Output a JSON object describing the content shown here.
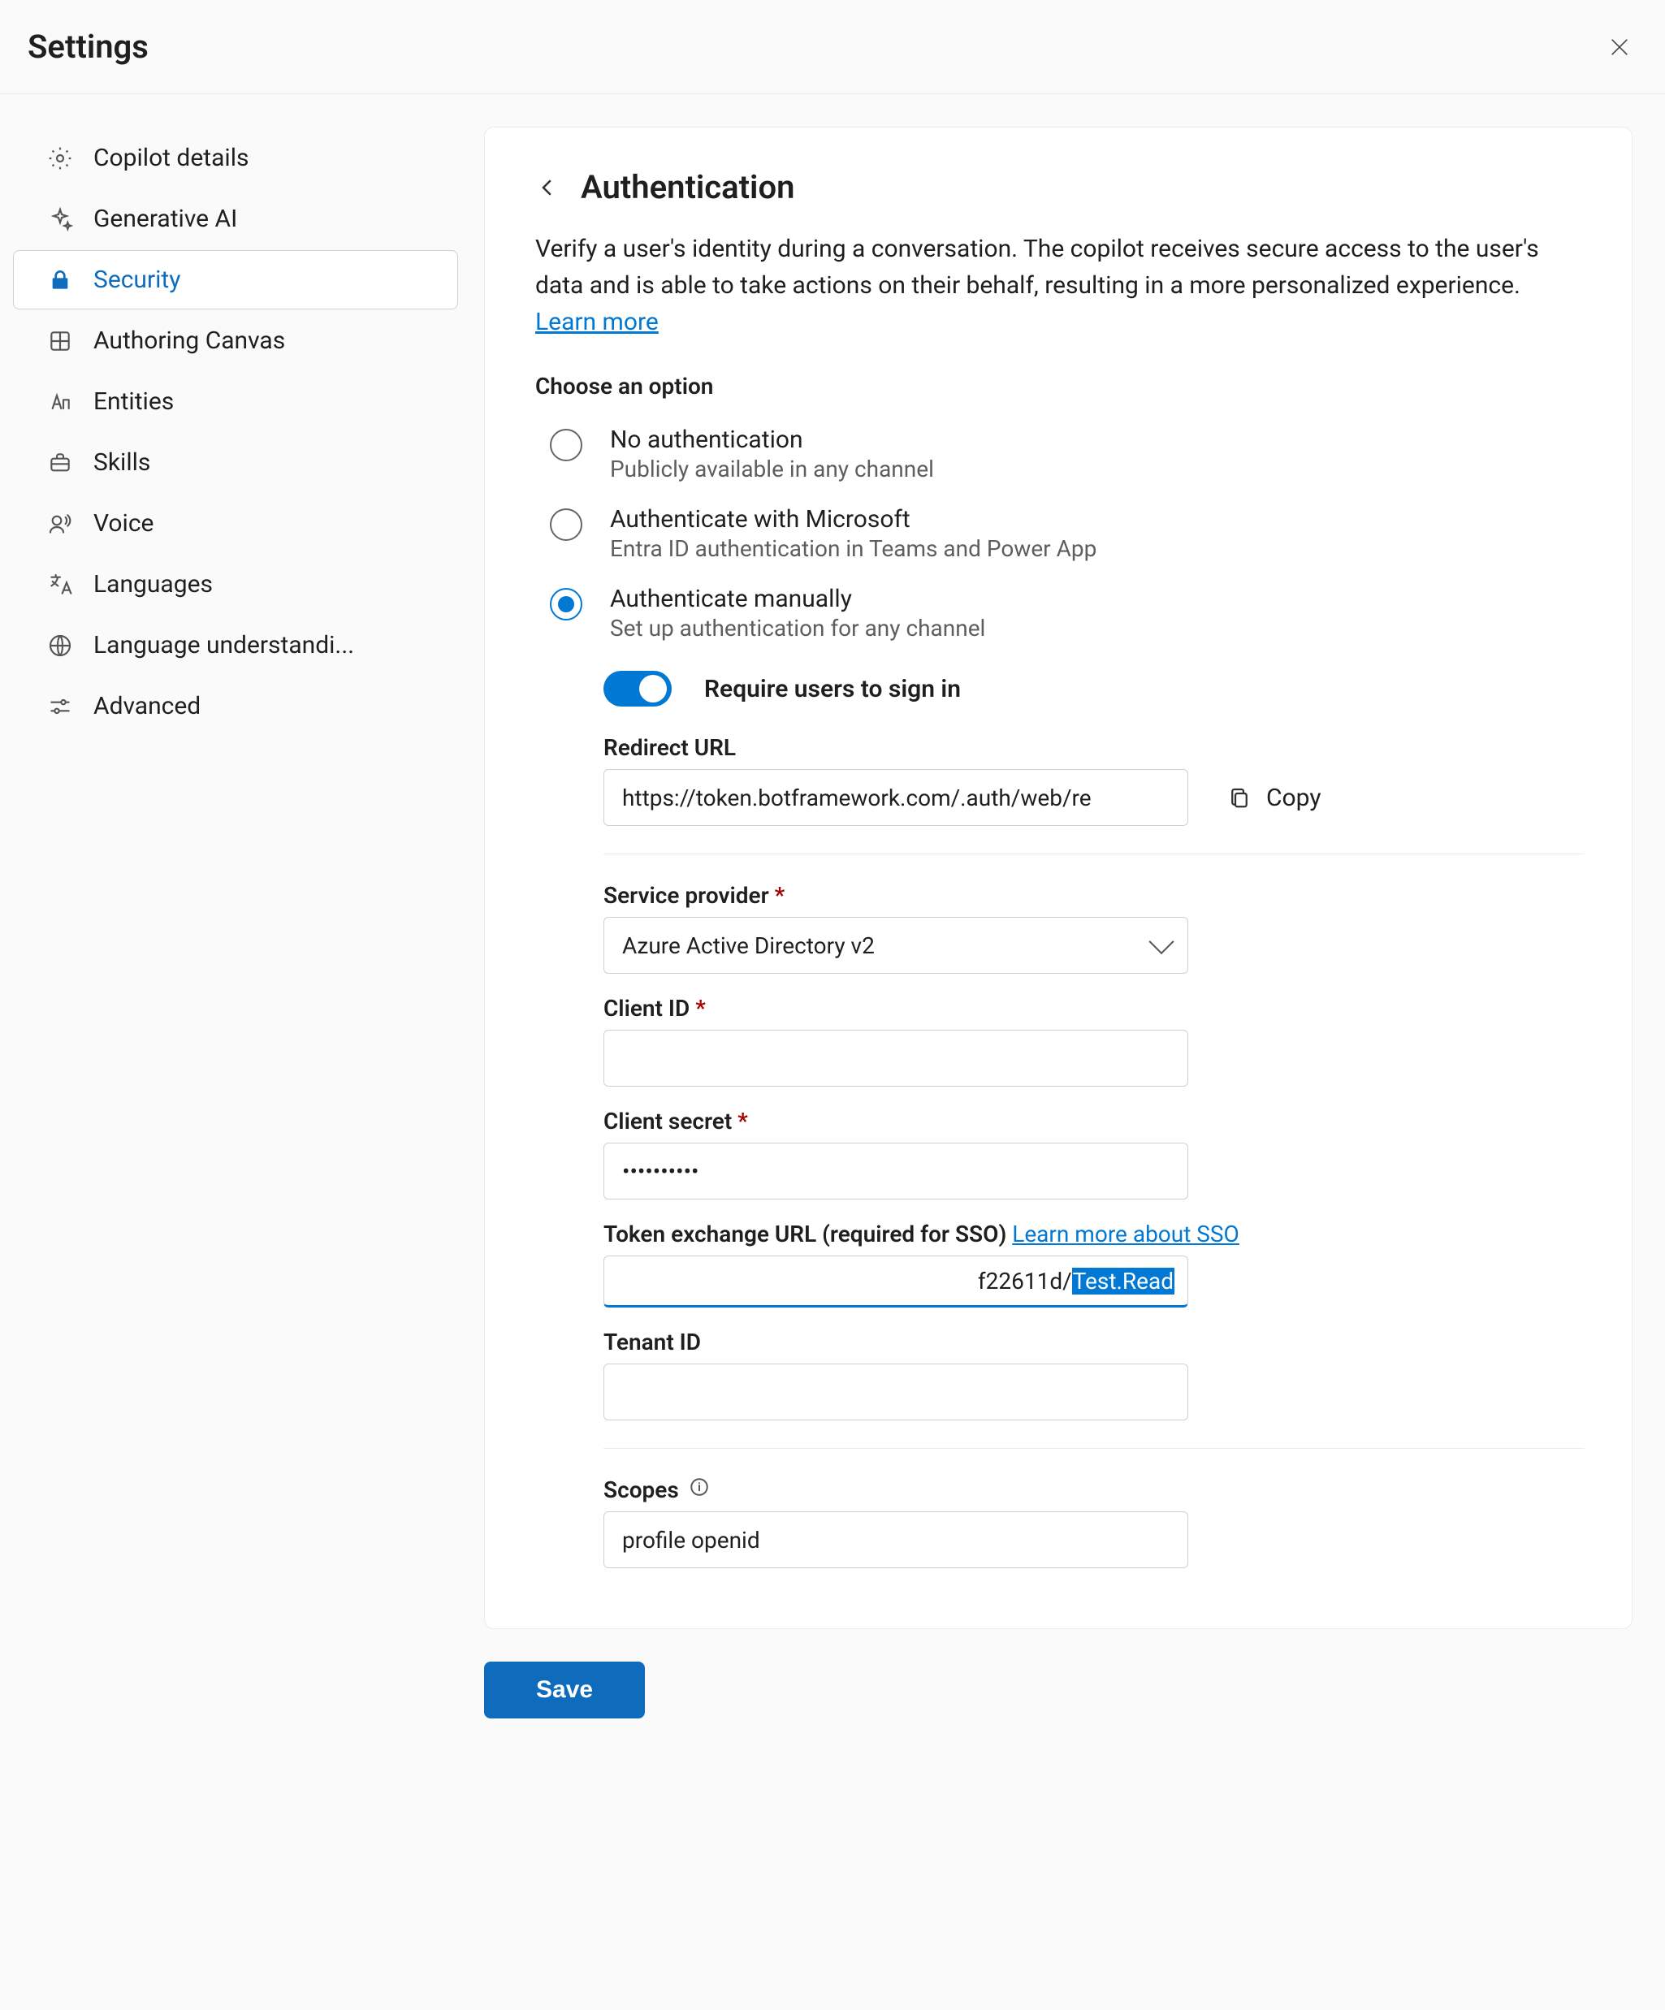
{
  "header": {
    "title": "Settings"
  },
  "sidebar": {
    "items": [
      {
        "id": "copilot-details",
        "label": "Copilot details",
        "icon": "gear"
      },
      {
        "id": "generative-ai",
        "label": "Generative AI",
        "icon": "sparkle"
      },
      {
        "id": "security",
        "label": "Security",
        "icon": "lock"
      },
      {
        "id": "authoring-canvas",
        "label": "Authoring Canvas",
        "icon": "grid"
      },
      {
        "id": "entities",
        "label": "Entities",
        "icon": "text"
      },
      {
        "id": "skills",
        "label": "Skills",
        "icon": "briefcase"
      },
      {
        "id": "voice",
        "label": "Voice",
        "icon": "voice"
      },
      {
        "id": "languages",
        "label": "Languages",
        "icon": "translate"
      },
      {
        "id": "language-understanding",
        "label": "Language understandi...",
        "icon": "globe"
      },
      {
        "id": "advanced",
        "label": "Advanced",
        "icon": "sliders"
      }
    ],
    "selected": "security"
  },
  "panel": {
    "title": "Authentication",
    "description": "Verify a user's identity during a conversation. The copilot receives secure access to the user's data and is able to take actions on their behalf, resulting in a more personalized experience. ",
    "learn_more": "Learn more",
    "choose_label": "Choose an option",
    "options": [
      {
        "id": "none",
        "title": "No authentication",
        "sub": "Publicly available in any channel"
      },
      {
        "id": "ms",
        "title": "Authenticate with Microsoft",
        "sub": "Entra ID authentication in Teams and Power App"
      },
      {
        "id": "manual",
        "title": "Authenticate manually",
        "sub": "Set up authentication for any channel"
      }
    ],
    "selected_option": "manual",
    "toggle": {
      "label": "Require users to sign in",
      "on": true
    },
    "redirect": {
      "label": "Redirect URL",
      "value": "https://token.botframework.com/.auth/web/re",
      "copy_label": "Copy"
    },
    "provider": {
      "label": "Service provider",
      "required": true,
      "value": "Azure Active Directory v2"
    },
    "client_id": {
      "label": "Client ID",
      "required": true,
      "value": ""
    },
    "client_secret": {
      "label": "Client secret",
      "required": true,
      "value": "••••••••••"
    },
    "token_exchange": {
      "label": "Token exchange URL (required for SSO) ",
      "learn_link": "Learn more about SSO",
      "value_prefix": "f22611d/",
      "value_selected": "Test.Read"
    },
    "tenant_id": {
      "label": "Tenant ID",
      "value": ""
    },
    "scopes": {
      "label": "Scopes",
      "value": "profile openid"
    }
  },
  "footer": {
    "save": "Save"
  }
}
